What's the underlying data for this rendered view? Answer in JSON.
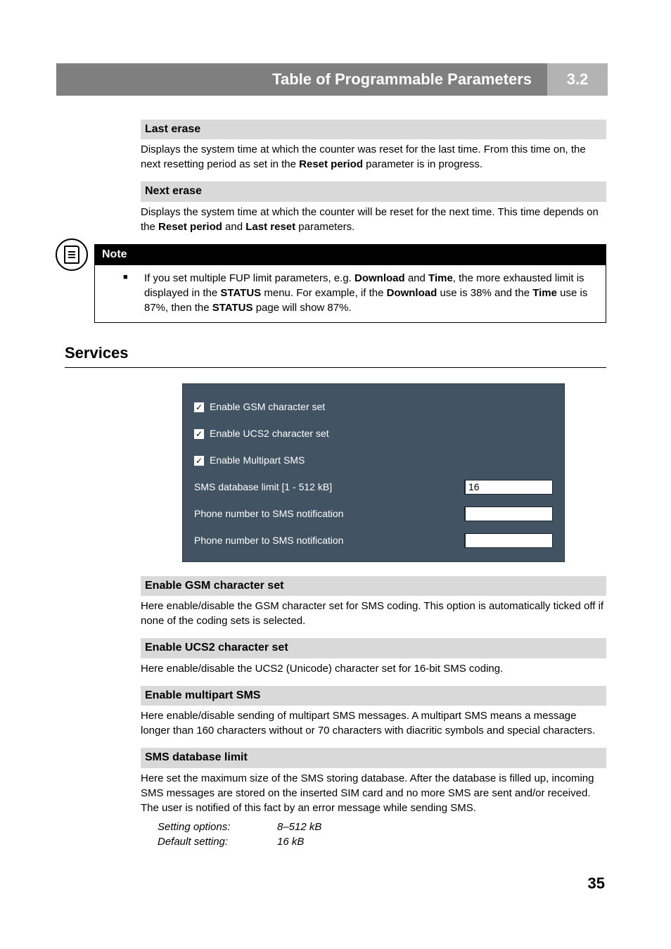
{
  "header": {
    "title": "Table of Programmable Parameters",
    "section_number": "3.2"
  },
  "last_erase": {
    "heading": "Last erase",
    "text_before_bold": "Displays the system time at which the counter was reset for the last time. From this time on, the next resetting period as set in the ",
    "bold": "Reset period",
    "text_after_bold": " parameter is in progress."
  },
  "next_erase": {
    "heading": "Next erase",
    "text_a": "Displays the system time at which the counter will be reset for the next time. This time depends on the ",
    "bold1": "Reset period",
    "mid": " and ",
    "bold2": "Last reset",
    "text_b": " parameters."
  },
  "note": {
    "label": "Note",
    "t1": "If you set multiple FUP limit parameters, e.g. ",
    "b1": "Download",
    "t2": " and ",
    "b2": "Time",
    "t3": ", the more exhausted limit is displayed in the ",
    "b3": "STATUS",
    "t4": " menu. For example, if the ",
    "b4": "Download",
    "t5": " use is 38% and the ",
    "b5": "Time",
    "t6": " use is 87%, then the ",
    "b6": "STATUS",
    "t7": " page will show 87%."
  },
  "services": {
    "heading": "Services",
    "settings_panel": {
      "enable_gsm": "Enable GSM character set",
      "enable_ucs2": "Enable UCS2 character set",
      "enable_multipart": "Enable Multipart SMS",
      "db_limit_label": "SMS database limit [1 - 512 kB]",
      "db_limit_value": "16",
      "phone1_label": "Phone number to SMS notification",
      "phone1_value": "",
      "phone2_label": "Phone number to SMS notification",
      "phone2_value": ""
    },
    "gsm": {
      "heading": "Enable GSM character set",
      "text": "Here enable/disable the GSM character set for SMS coding. This option is automatically ticked off if none of the coding sets is selected."
    },
    "ucs2": {
      "heading": "Enable UCS2 character set",
      "text": "Here enable/disable the UCS2 (Unicode) character set for 16-bit SMS coding."
    },
    "multipart": {
      "heading": "Enable multipart SMS",
      "text": "Here enable/disable sending of multipart SMS messages. A multipart SMS means a message longer than 160 characters without or 70 characters with diacritic symbols and special characters."
    },
    "dblimit": {
      "heading": "SMS database limit",
      "text": "Here set the maximum size of the SMS storing database. After the database is filled up, incoming SMS messages are stored on the inserted SIM card and no more SMS are sent and/or received. The user is notified of this fact by an error message while sending SMS.",
      "setting_options_label": "Setting options:",
      "setting_options_value": "8–512 kB",
      "default_label": "Default setting:",
      "default_value": "16 kB"
    }
  },
  "page_number": "35",
  "chart_data": {
    "type": "table",
    "title": "Services settings panel values",
    "rows": [
      {
        "field": "Enable GSM character set",
        "value": true
      },
      {
        "field": "Enable UCS2 character set",
        "value": true
      },
      {
        "field": "Enable Multipart SMS",
        "value": true
      },
      {
        "field": "SMS database limit [1 - 512 kB]",
        "value": 16
      },
      {
        "field": "Phone number to SMS notification",
        "value": ""
      },
      {
        "field": "Phone number to SMS notification",
        "value": ""
      }
    ]
  }
}
